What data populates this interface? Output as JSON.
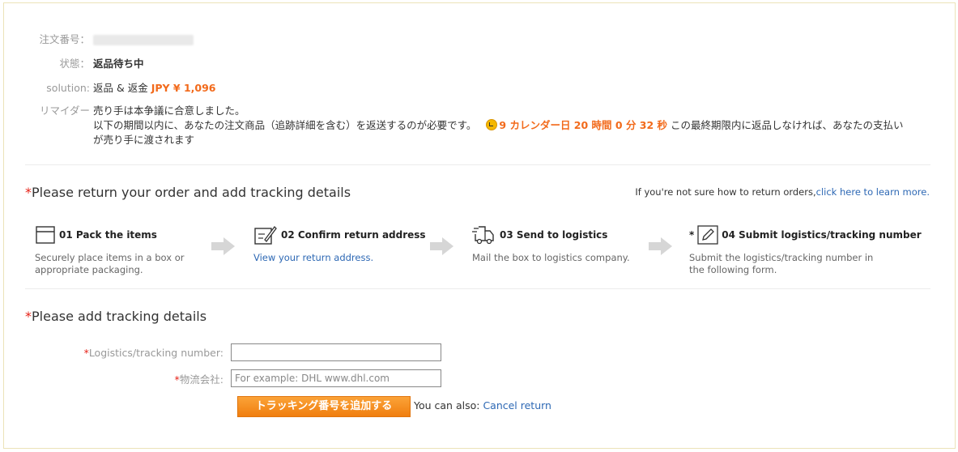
{
  "order": {
    "order_no_label": "注文番号：",
    "status_label": "状態：",
    "status_value": "返品待ち中",
    "solution_label": "solution:",
    "solution_text": "返品 & 返金",
    "solution_amount": "JPY ¥ 1,096",
    "reminder_label": "リマイダー",
    "reminder_line1": "売り手は本争議に合意しました。",
    "reminder_line2": "以下の期間以内に、あなたの注文商品（追跡詳細を含む）を返送するのが必要です。",
    "countdown": "9 カレンダー日 20 時間 0 分 32 秒",
    "reminder_tail": "この最終期限内に返品しなければ、あなたの支払い",
    "reminder_line3": "が売り手に渡されます"
  },
  "return_section": {
    "asterisk": "*",
    "title": "Please return your order and add tracking details",
    "help_prefix": "If you're not sure how to return orders,",
    "help_link": "click here to learn more."
  },
  "steps": [
    {
      "title": "01 Pack the items",
      "desc": "Securely place items in a box or appropriate packaging.",
      "icon": "box-icon"
    },
    {
      "title": "02 Confirm return address",
      "desc_link": "View your return address.",
      "icon": "edit-form-icon"
    },
    {
      "title": "03 Send to logistics",
      "desc": "Mail the box to logistics company.",
      "icon": "truck-icon"
    },
    {
      "title": "04 Submit logistics/tracking number",
      "desc": "Submit the logistics/tracking number in the following form.",
      "icon": "pencil-icon",
      "marker": "*"
    }
  ],
  "tracking_section": {
    "asterisk": "*",
    "title": "Please add tracking details"
  },
  "form": {
    "tracking_label": "Logistics/tracking number:",
    "tracking_value": "",
    "company_label": "物流会社:",
    "company_placeholder": "For example: DHL www.dhl.com",
    "required_mark": "*"
  },
  "actions": {
    "add_button": "トラッキング番号を追加する",
    "also_text": "You can also:",
    "cancel_link": "Cancel return"
  },
  "colors": {
    "accent_orange": "#f26a1b",
    "status_green": "#2c9d3b",
    "link_blue": "#2d68b4",
    "required_red": "#e62117"
  }
}
